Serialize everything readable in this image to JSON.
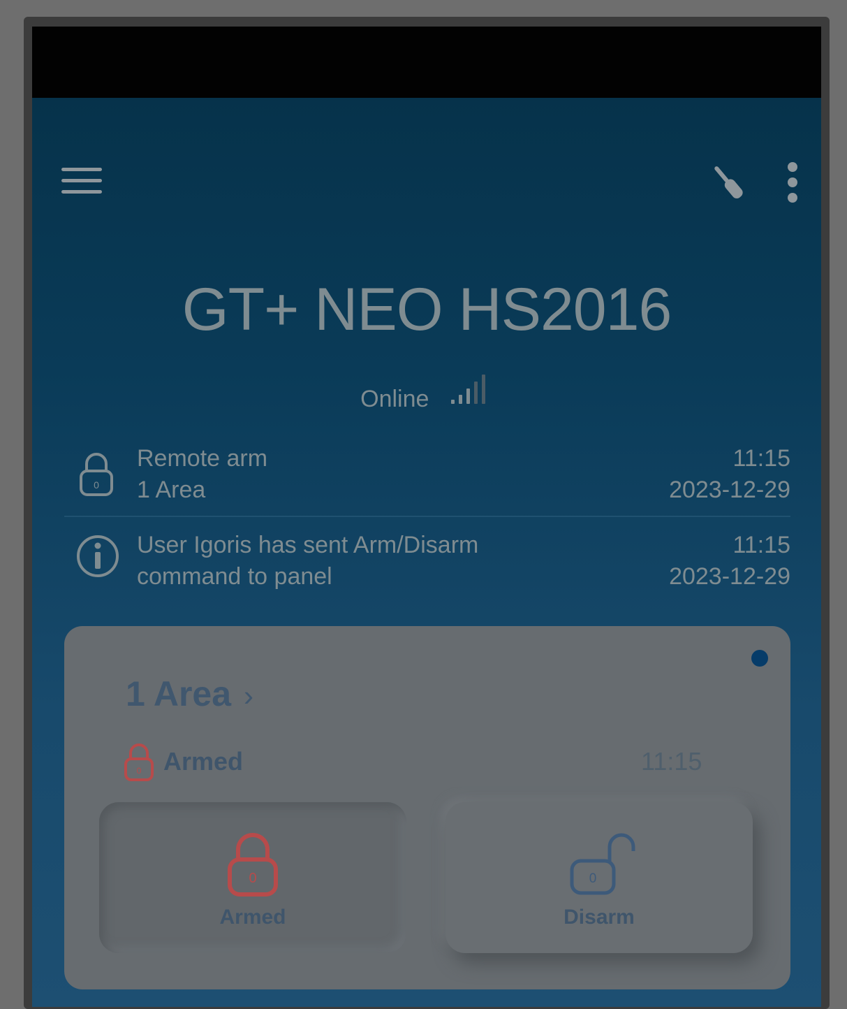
{
  "app": {
    "panel_name": "GT+ NEO HS2016",
    "connection_status": "Online",
    "signal_bars_filled": 3,
    "signal_bars_total": 5
  },
  "toolbar": {
    "menu_icon": "hamburger-menu-icon",
    "tool_icon": "wrench-icon",
    "more_icon": "more-vertical-icon"
  },
  "events": [
    {
      "icon": "lock-icon",
      "line1": "Remote arm",
      "line2": "1 Area",
      "time": "11:15",
      "date": "2023-12-29"
    },
    {
      "icon": "info-icon",
      "line1": "User Igoris has sent Arm/Disarm",
      "line2": "command to panel",
      "time": "11:15",
      "date": "2023-12-29"
    }
  ],
  "area_card": {
    "title": "1 Area",
    "chevron": "›",
    "status": "Armed",
    "status_time": "11:15",
    "actions": [
      {
        "label": "Armed",
        "icon": "lock-closed-icon"
      },
      {
        "label": "Disarm",
        "icon": "lock-open-icon"
      }
    ]
  },
  "colors": {
    "armed": "#b74b4b",
    "disarm": "#3d5a7a",
    "header_gradient_top": "#053047",
    "header_gradient_bottom": "#1d4f72"
  }
}
